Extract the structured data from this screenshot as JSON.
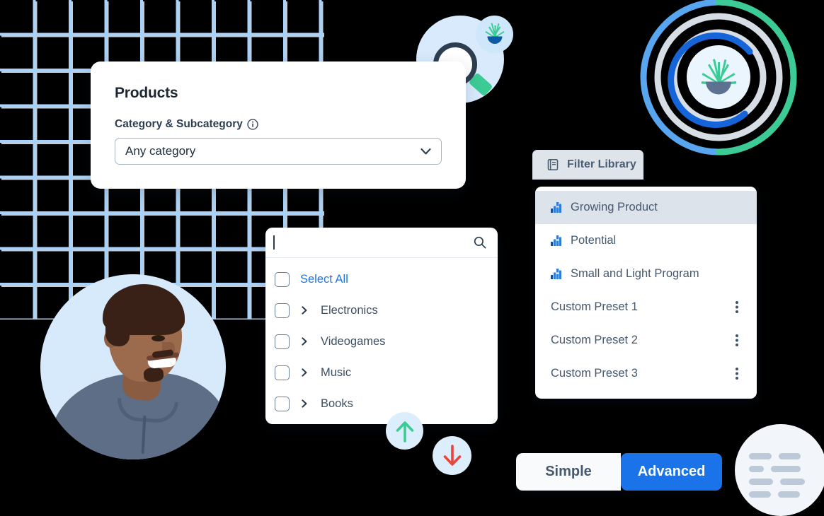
{
  "products_card": {
    "title": "Products",
    "field_label": "Category & Subcategory",
    "info_icon": "info-circle-icon",
    "select_value": "Any category",
    "chevron_icon": "chevron-down-icon"
  },
  "category_dropdown": {
    "search_value": "",
    "search_placeholder": "",
    "search_icon": "search-icon",
    "items": [
      {
        "label": "Select All",
        "type": "select-all",
        "checked": false,
        "expandable": false
      },
      {
        "label": "Electronics",
        "type": "category",
        "checked": false,
        "expandable": true
      },
      {
        "label": "Videogames",
        "type": "category",
        "checked": false,
        "expandable": true
      },
      {
        "label": "Music",
        "type": "category",
        "checked": false,
        "expandable": true
      },
      {
        "label": "Books",
        "type": "category",
        "checked": false,
        "expandable": true
      }
    ]
  },
  "filter_library": {
    "tab_label": "Filter Library",
    "tab_icon": "book-icon",
    "items": [
      {
        "label": "Growing Product",
        "icon": "bar-chart-icon",
        "active": true,
        "menu": false
      },
      {
        "label": "Potential",
        "icon": "bar-chart-icon",
        "active": false,
        "menu": false
      },
      {
        "label": "Small and Light Program",
        "icon": "bar-chart-icon",
        "active": false,
        "menu": false
      },
      {
        "label": "Custom Preset 1",
        "icon": "",
        "active": false,
        "menu": true
      },
      {
        "label": "Custom Preset 2",
        "icon": "",
        "active": false,
        "menu": true
      },
      {
        "label": "Custom Preset 3",
        "icon": "",
        "active": false,
        "menu": true
      }
    ],
    "menu_icon": "more-vertical-icon"
  },
  "mode_toggle": {
    "simple_label": "Simple",
    "advanced_label": "Advanced",
    "selected": "Advanced"
  },
  "decorations": {
    "magnifier_icon": "magnifying-glass-illustration",
    "magnifier_badge_icon": "plant-icon",
    "target_rings_icon": "concentric-rings-illustration",
    "target_center_icon": "plant-icon",
    "arrow_up_icon": "arrow-up-icon",
    "arrow_down_icon": "arrow-down-icon",
    "person_photo": "person-portrait-photo",
    "grid_pattern": "grid-pattern",
    "text-lines_icon": "text-lines-circle-icon"
  },
  "colors": {
    "accent_blue": "#1a73e8",
    "link_blue": "#1c76dd",
    "grid_blue": "#a9d2fa",
    "grid_shadow": "#c3ccd6",
    "slate_text": "#44586e",
    "dark_text": "#1b2733",
    "panel_bg": "#ffffff",
    "tab_bg": "#dfe4ea",
    "active_row_bg": "#dde3ea",
    "light_blue_circle": "#d8eafb",
    "green": "#3ccb95",
    "red": "#e8453c",
    "pot_slate": "#5d7290"
  }
}
